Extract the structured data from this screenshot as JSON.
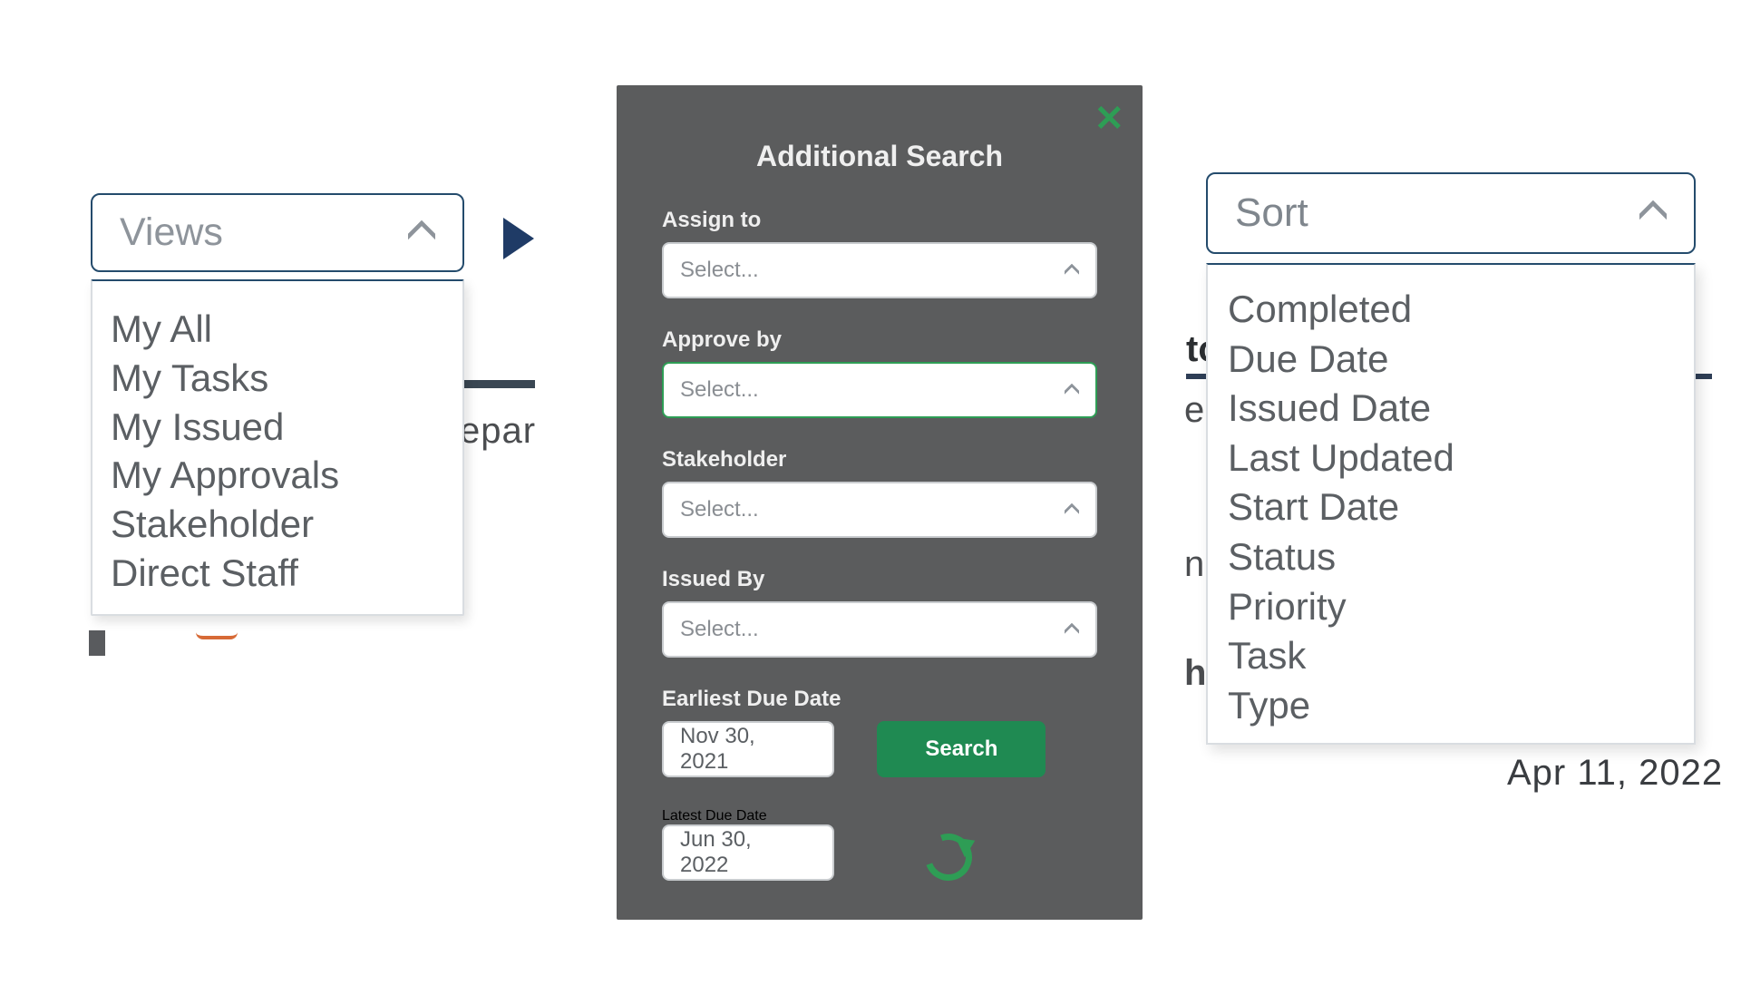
{
  "views": {
    "label": "Views",
    "options": [
      "My All",
      "My Tasks",
      "My Issued",
      "My Approvals",
      "Stakeholder",
      "Direct Staff"
    ]
  },
  "bg_left": {
    "epar": "epar"
  },
  "panel": {
    "title": "Additional Search",
    "close_glyph": "✕",
    "fields": {
      "assign_to": {
        "label": "Assign to",
        "placeholder": "Select..."
      },
      "approve_by": {
        "label": "Approve by",
        "placeholder": "Select..."
      },
      "stakeholder": {
        "label": "Stakeholder",
        "placeholder": "Select..."
      },
      "issued_by": {
        "label": "Issued By",
        "placeholder": "Select..."
      }
    },
    "earliest": {
      "label": "Earliest Due Date",
      "value": "Nov 30, 2021"
    },
    "latest": {
      "label": "Latest Due Date",
      "value": "Jun 30, 2022"
    },
    "search_label": "Search"
  },
  "sort": {
    "label": "Sort",
    "options": [
      "Completed",
      "Due Date",
      "Issued Date",
      "Last Updated",
      "Start Date",
      "Status",
      "Priority",
      "Task",
      "Type"
    ]
  },
  "bg_right": {
    "to": "to",
    "e": "e",
    "n": "n",
    "h": "h",
    "date": "Apr 11, 2022"
  }
}
